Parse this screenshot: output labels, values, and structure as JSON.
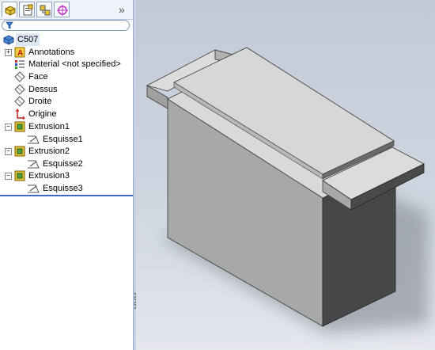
{
  "tree": {
    "root": "C507",
    "items": [
      {
        "label": "Annotations",
        "icon": "annotations-icon"
      },
      {
        "label": "Material <not specified>",
        "icon": "material-icon"
      },
      {
        "label": "Face",
        "icon": "plane-icon"
      },
      {
        "label": "Dessus",
        "icon": "plane-icon"
      },
      {
        "label": "Droite",
        "icon": "plane-icon"
      },
      {
        "label": "Origine",
        "icon": "origin-icon"
      },
      {
        "label": "Extrusion1",
        "icon": "extrude-icon"
      },
      {
        "label": "Esquisse1",
        "icon": "sketch-icon"
      },
      {
        "label": "Extrusion2",
        "icon": "extrude-icon"
      },
      {
        "label": "Esquisse2",
        "icon": "sketch-icon"
      },
      {
        "label": "Extrusion3",
        "icon": "extrude-icon"
      },
      {
        "label": "Esquisse3",
        "icon": "sketch-icon"
      }
    ]
  },
  "tabs": [
    "featuremanager-tab",
    "propertymanager-tab",
    "configurationmanager-tab",
    "dimxpert-tab"
  ],
  "chevron": "»",
  "colors": {
    "accent": "#3a6bc8",
    "model_light": "#d8d8d8",
    "model_mid": "#a9a9a9",
    "model_dark": "#4a4a4a"
  }
}
